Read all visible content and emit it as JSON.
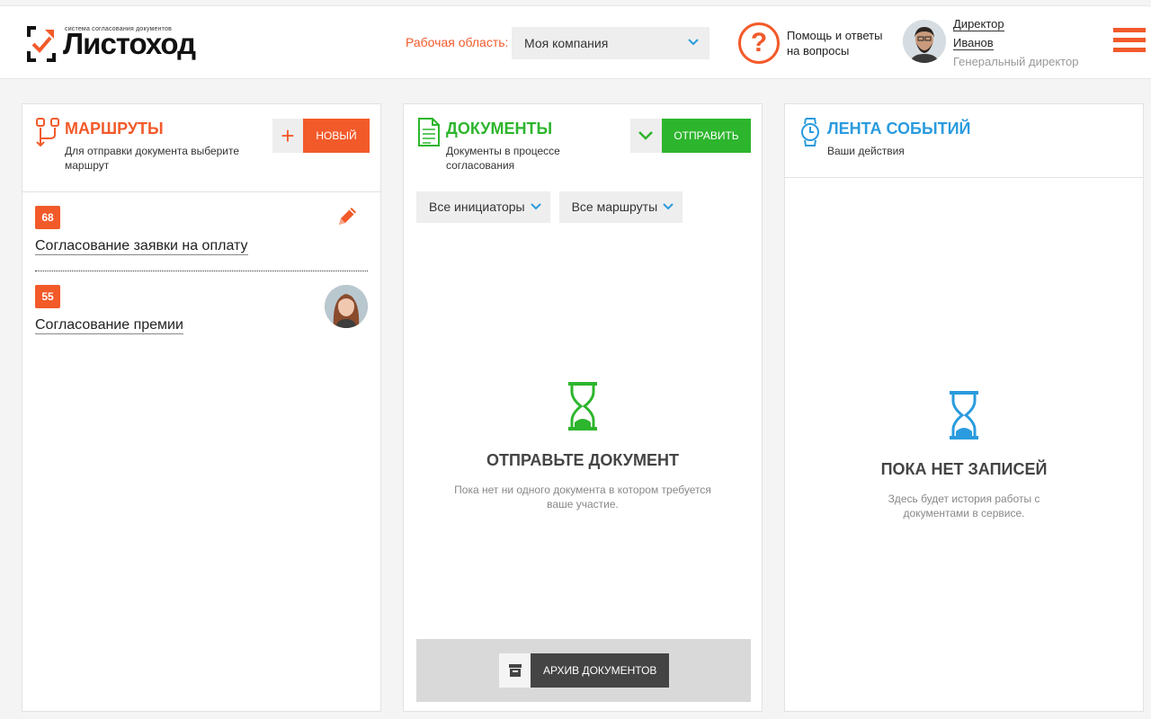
{
  "header": {
    "logo_subtitle": "система согласования документов",
    "logo_name": "Листоход",
    "workspace_label": "Рабочая область:",
    "workspace_value": "Моя компания",
    "help_symbol": "?",
    "help_text": "Помощь и ответы на вопросы",
    "user_role": "Директор",
    "user_name": "Иванов",
    "user_position": "Генеральный директор"
  },
  "routes_panel": {
    "title": "МАРШРУТЫ",
    "subtitle": "Для отправки документа выберите маршрут",
    "new_button_plus": "+",
    "new_button_label": "НОВЫЙ",
    "items": [
      {
        "count": "68",
        "name": "Согласование заявки на оплату"
      },
      {
        "count": "55",
        "name": "Согласование премии"
      }
    ]
  },
  "documents_panel": {
    "title": "ДОКУМЕНТЫ",
    "subtitle": "Документы в процессе согласования",
    "send_button_label": "ОТПРАВИТЬ",
    "filter_initiators": "Все инициаторы",
    "filter_routes": "Все маршруты",
    "empty_title": "ОТПРАВЬТЕ ДОКУМЕНТ",
    "empty_text": "Пока нет ни одного документа в котором требуется ваше участие.",
    "archive_button_label": "АРХИВ ДОКУМЕНТОВ"
  },
  "events_panel": {
    "title": "ЛЕНТА СОБЫТИЙ",
    "subtitle": "Ваши действия",
    "empty_title": "ПОКА НЕТ ЗАПИСЕЙ",
    "empty_text": "Здесь будет история работы с документами в сервисе."
  },
  "colors": {
    "accent_orange": "#f25a2a",
    "accent_green": "#2db52d",
    "accent_blue": "#2a9bde"
  }
}
